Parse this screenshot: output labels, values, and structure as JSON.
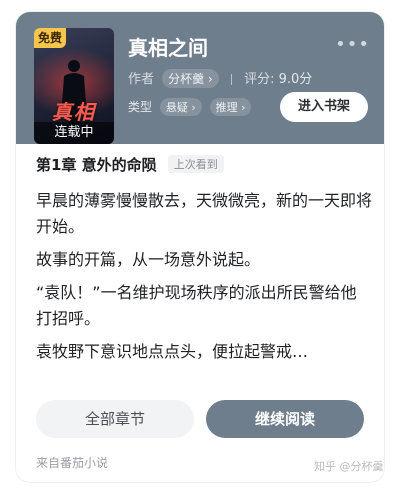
{
  "book": {
    "free_badge": "免费",
    "cover_title": "真相",
    "serial_status": "连载中",
    "title": "真相之间",
    "author_label": "作者",
    "author": "分杯羹",
    "score_label": "评分:",
    "score": "9.0分",
    "genre_label": "类型",
    "genres": [
      "悬疑",
      "推理"
    ],
    "shelf_button": "进入书架",
    "more_icon": "more-dots-icon"
  },
  "chapter": {
    "title": "第1章 意外的命陨",
    "last_read": "上次看到"
  },
  "excerpt": [
    "早晨的薄雾慢慢散去，天微微亮，新的一天即将开始。",
    "故事的开篇，从一场意外说起。",
    "“袁队！”一名维护现场秩序的派出所民警给他打招呼。",
    "袁牧野下意识地点点头，便拉起警戒…"
  ],
  "actions": {
    "all_chapters": "全部章节",
    "continue_reading": "继续阅读"
  },
  "footer": {
    "source": "来自番茄小说",
    "watermark": "知乎 @分杯羹"
  },
  "colors": {
    "header_bg": "#6f7e8c",
    "badge_bg": "#f6c64c",
    "cover_title": "#ff5a4e"
  }
}
